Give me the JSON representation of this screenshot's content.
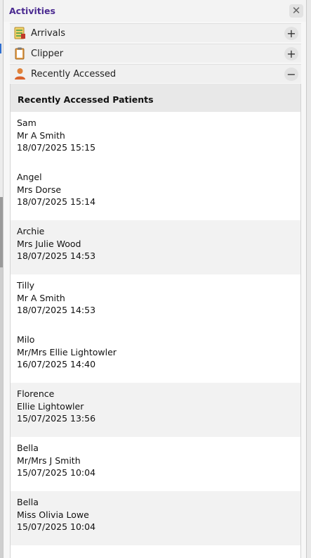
{
  "panel": {
    "title": "Activities",
    "close_icon": "close-icon"
  },
  "sections": [
    {
      "label": "Arrivals",
      "icon": "arrivals-list-icon",
      "toggle": "+"
    },
    {
      "label": "Clipper",
      "icon": "clipboard-icon",
      "toggle": "+"
    },
    {
      "label": "Recently Accessed",
      "icon": "person-icon",
      "toggle": "−"
    }
  ],
  "recent": {
    "header": "Recently Accessed Patients",
    "patients": [
      {
        "pet": "Sam",
        "owner": "Mr A Smith",
        "datetime": "18/07/2025 15:15"
      },
      {
        "pet": "Angel",
        "owner": "Mrs Dorse",
        "datetime": "18/07/2025 15:14"
      },
      {
        "pet": "Archie",
        "owner": "Mrs Julie Wood",
        "datetime": "18/07/2025 14:53"
      },
      {
        "pet": "Tilly",
        "owner": "Mr A Smith",
        "datetime": "18/07/2025 14:53"
      },
      {
        "pet": "Milo",
        "owner": "Mr/Mrs Ellie Lightowler",
        "datetime": "16/07/2025 14:40"
      },
      {
        "pet": "Florence",
        "owner": "Ellie Lightowler",
        "datetime": "15/07/2025 13:56"
      },
      {
        "pet": "Bella",
        "owner": "Mr/Mrs J Smith",
        "datetime": "15/07/2025 10:04"
      },
      {
        "pet": "Bella",
        "owner": "Miss Olivia Lowe",
        "datetime": "15/07/2025 10:04"
      }
    ]
  },
  "colors": {
    "title": "#4b2b91",
    "hover_row": "#f2f2f2"
  }
}
